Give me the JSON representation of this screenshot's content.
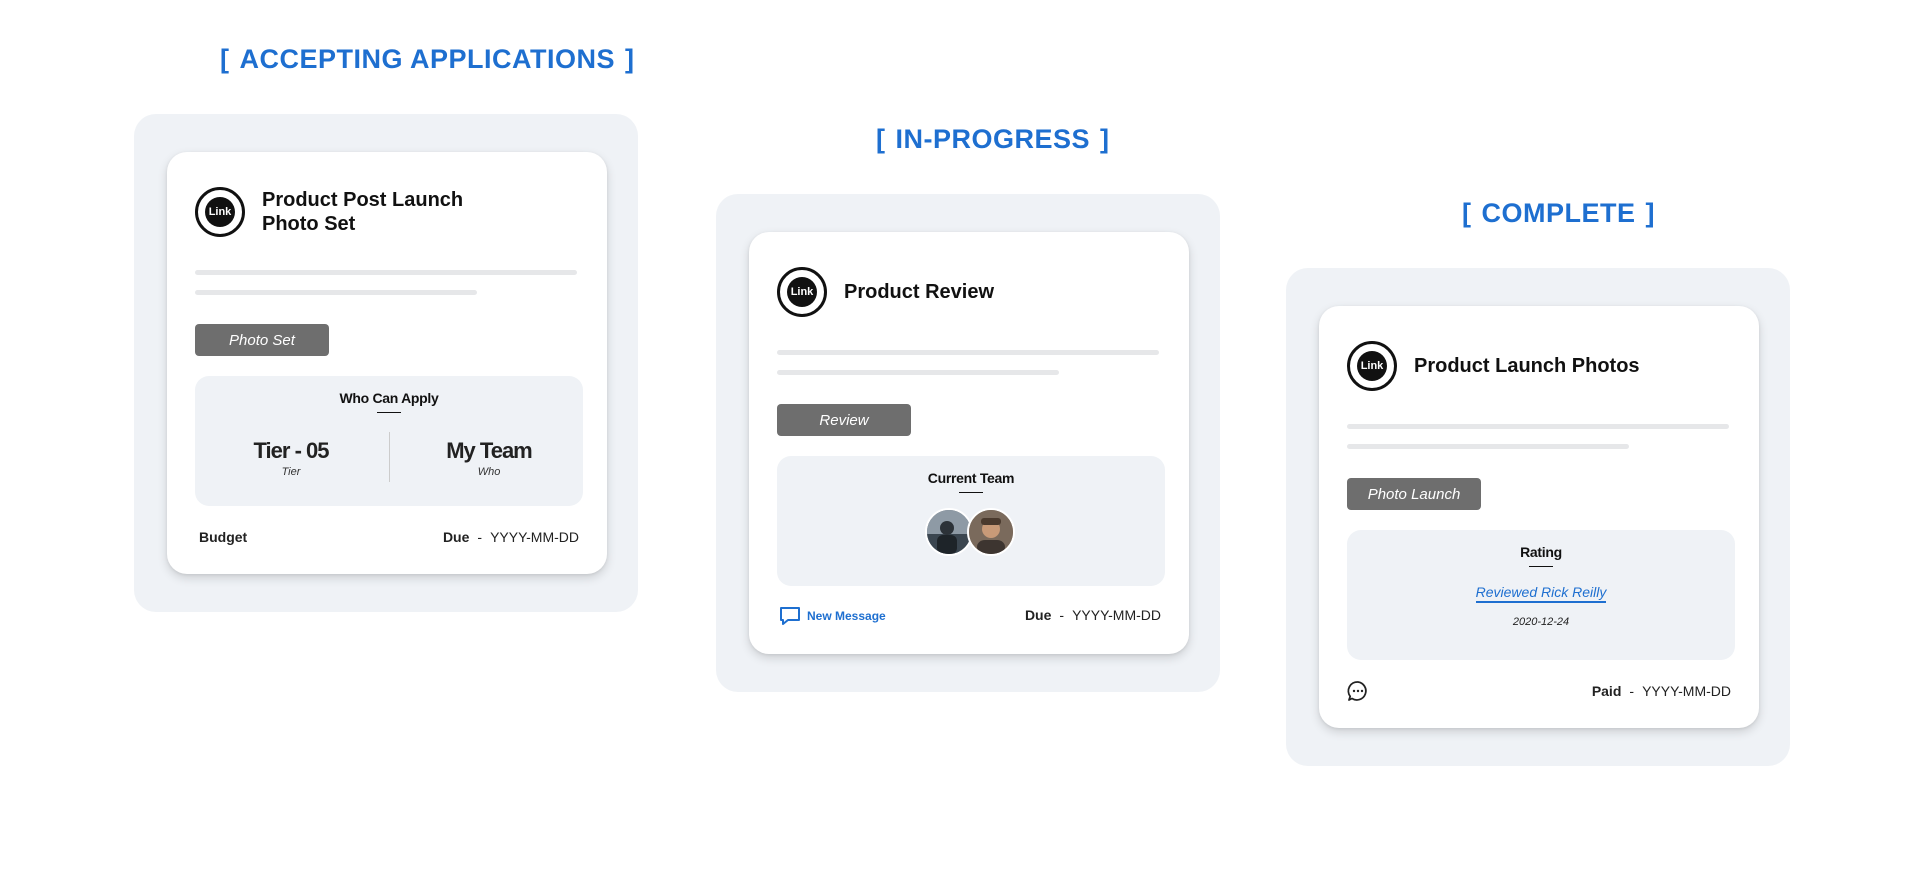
{
  "columns": [
    {
      "heading": "ACCEPTING APPLICATIONS",
      "card": {
        "logo_text": "Link",
        "title_line1": "Product Post Launch",
        "title_line2": "Photo Set",
        "category": "Photo Set",
        "section_heading": "Who Can Apply",
        "stats": [
          {
            "value": "Tier - 05",
            "label": "Tier"
          },
          {
            "value": "My Team",
            "label": "Who"
          }
        ],
        "footer_left": "Budget",
        "footer_right_label": "Due",
        "footer_right_sep": "-",
        "footer_right_value": "YYYY-MM-DD"
      }
    },
    {
      "heading": "IN-PROGRESS",
      "card": {
        "logo_text": "Link",
        "title": "Product Review",
        "category": "Review",
        "section_heading": "Current Team",
        "footer_left": "New Message",
        "footer_right_label": "Due",
        "footer_right_sep": "-",
        "footer_right_value": "YYYY-MM-DD"
      }
    },
    {
      "heading": "COMPLETE",
      "card": {
        "logo_text": "Link",
        "title": "Product Launch Photos",
        "category": "Photo Launch",
        "section_heading": "Rating",
        "review_link": "Reviewed Rick Reilly",
        "review_date": "2020-12-24",
        "footer_right_label": "Paid",
        "footer_right_sep": "-",
        "footer_right_value": "YYYY-MM-DD"
      }
    }
  ],
  "bracket_open": "[",
  "bracket_close": "]",
  "icons": {
    "message": "message-square-icon",
    "chat": "chat-bubble-icon",
    "avatar": "avatar"
  },
  "colors": {
    "accent": "#1e6fd0",
    "panel": "#eff2f6",
    "category_chip": "#6e6e6e"
  }
}
